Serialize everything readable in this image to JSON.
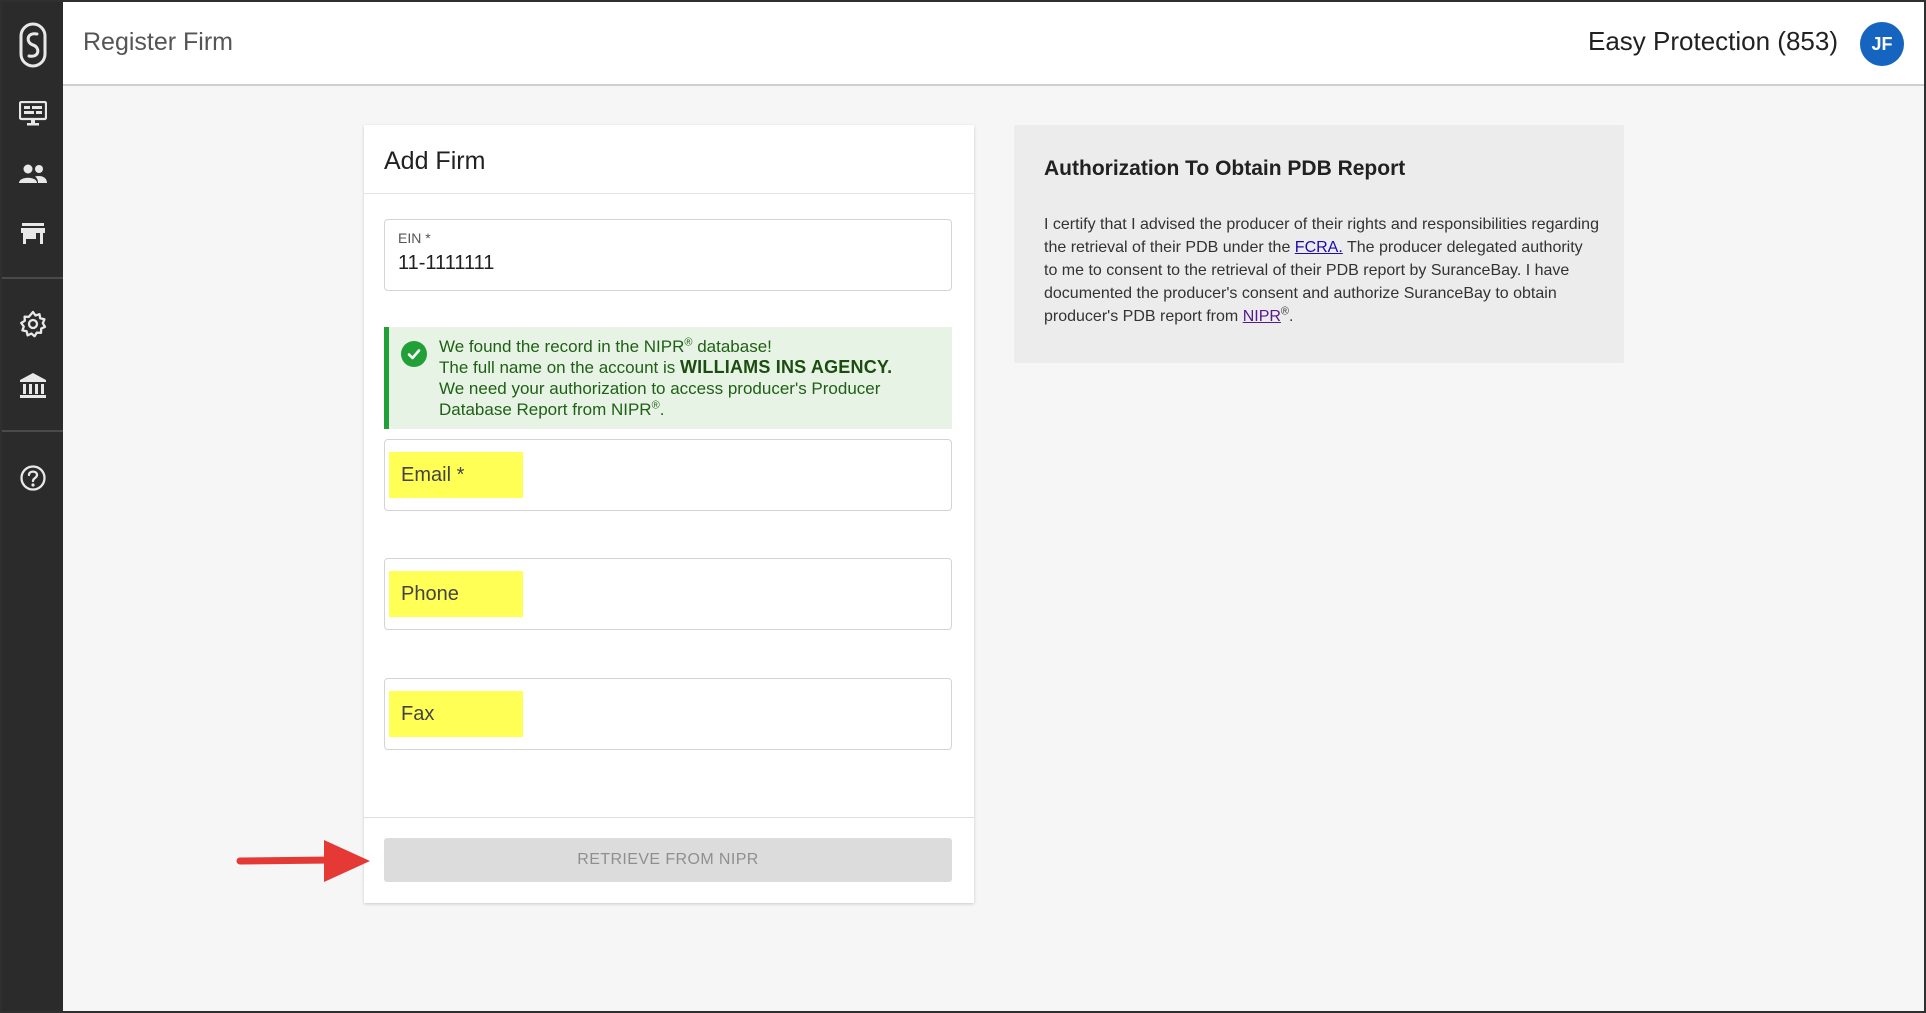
{
  "header": {
    "page_title": "Register Firm",
    "account_name": "Easy Protection (853)",
    "avatar_initials": "JF"
  },
  "sidebar": {
    "items": [
      {
        "name": "dashboard",
        "icon": "monitor-icon"
      },
      {
        "name": "people",
        "icon": "people-icon"
      },
      {
        "name": "store",
        "icon": "store-icon"
      },
      {
        "name": "settings",
        "icon": "gear-icon"
      },
      {
        "name": "institution",
        "icon": "bank-icon"
      },
      {
        "name": "help",
        "icon": "help-icon"
      }
    ]
  },
  "form": {
    "title": "Add Firm",
    "ein": {
      "label": "EIN *",
      "value": "11-1111111"
    },
    "notice": {
      "line1_a": "We found the record in the NIPR",
      "line1_b": " database!",
      "line2_a": "The full name on the account is ",
      "firm_name": "WILLIAMS INS AGENCY.",
      "line3": "We need your authorization to access producer's Producer Database Report from NIPR",
      "line3_end": ".",
      "registered": "®"
    },
    "email_placeholder": "Email *",
    "phone_placeholder": "Phone",
    "fax_placeholder": "Fax",
    "submit_label": "RETRIEVE FROM NIPR"
  },
  "authorization": {
    "title": "Authorization To Obtain PDB Report",
    "text_1": "I certify that I advised the producer of their rights and responsibilities regarding the retrieval of their PDB under the ",
    "link_fcra": "FCRA.",
    "text_2": " The producer delegated authority to me to consent to the retrieval of their PDB report by SuranceBay. I have documented the producer's consent and authorize SuranceBay to obtain producer's PDB report from ",
    "link_nipr": "NIPR",
    "registered": "®",
    "text_3": "."
  },
  "colors": {
    "sidebar_bg": "#2b2b2b",
    "avatar_bg": "#1565c0",
    "success_green": "#21a038",
    "highlight_yellow": "#ffff55",
    "annotation_arrow": "#e53935"
  }
}
